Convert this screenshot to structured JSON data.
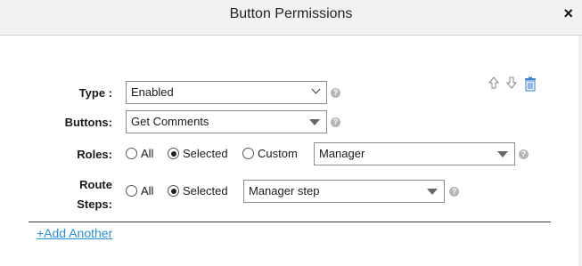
{
  "dialog": {
    "title": "Button Permissions",
    "close_icon": "×"
  },
  "form": {
    "type": {
      "label": "Type :",
      "value": "Enabled"
    },
    "buttons": {
      "label": "Buttons:",
      "value": "Get Comments"
    },
    "roles": {
      "label": "Roles:",
      "options": [
        "All",
        "Selected",
        "Custom"
      ],
      "selected": "Selected",
      "value": "Manager"
    },
    "route_steps": {
      "label_line1": "Route",
      "label_line2": "Steps:",
      "options": [
        "All",
        "Selected"
      ],
      "selected": "Selected",
      "value": "Manager step"
    },
    "help_glyph": "?"
  },
  "actions": {
    "add_another": "+Add Another",
    "move_up_icon": "arrow-up-icon",
    "move_down_icon": "arrow-down-icon",
    "delete_icon": "trash-icon"
  },
  "colors": {
    "link": "#2b8fd1",
    "trash": "#3a7fd0"
  }
}
